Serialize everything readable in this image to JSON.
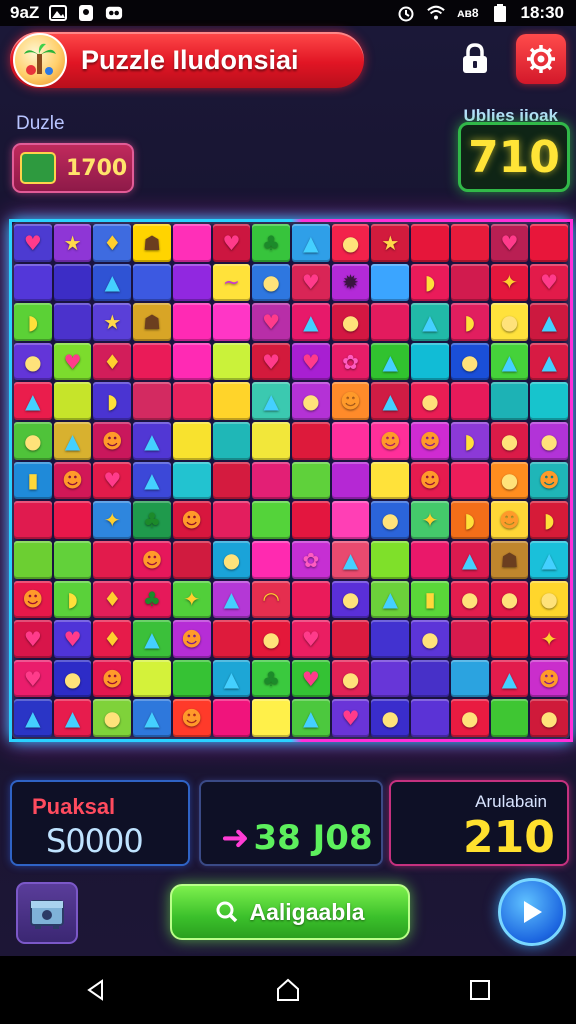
{
  "status_bar": {
    "carrier": "9aZ",
    "signal": "ᴀʙ8",
    "time": "18:30"
  },
  "header": {
    "title": "Puzzle Iludonsiai"
  },
  "left_panel": {
    "label": "Duzle",
    "chip_value": "1700"
  },
  "right_panel": {
    "label": "Ublies iioak",
    "score": "710"
  },
  "board": {
    "columns": 14,
    "rows": 13,
    "tiles": [
      [
        "#4c3bd1",
        "♥",
        "#8e36d6",
        "★",
        "#3e6be0",
        "♦",
        "#ffd400",
        "☗",
        "#ff2fb8",
        "",
        "#cc1640",
        "♥",
        "#37c43c",
        "♣",
        "#2f9fe8",
        "▲",
        "#f2224b",
        "●",
        "#d21b3d",
        "★",
        "#e6163a",
        "",
        "#e61b3b",
        "",
        "#b91f53",
        "♥",
        "#e8163a",
        ""
      ],
      [
        "#5337d9",
        "",
        "#3c2dc6",
        "",
        "#2f53d4",
        "▲",
        "#3c59e1",
        "",
        "#9128e0",
        "",
        "#ffe23a",
        "~",
        "#2e77e0",
        "●",
        "#d92556",
        "♥",
        "#b32ad8",
        "✹",
        "#3ba5ff",
        "",
        "#ea1b5a",
        "◗",
        "#d11b4e",
        "",
        "#e4173d",
        "✦",
        "#e21b4a",
        "♥"
      ],
      [
        "#5bd136",
        "◗",
        "#4b32cc",
        "",
        "#5a3fd8",
        "★",
        "#d8a526",
        "☗",
        "#ff2ab4",
        "",
        "#ff36c6",
        "",
        "#b82ea8",
        "♥",
        "#e7196a",
        "▲",
        "#d31742",
        "●",
        "#e31b5e",
        "",
        "#21b9a8",
        "▲",
        "#e11e5f",
        "◗",
        "#ffe23c",
        "●",
        "#cc193f",
        "▲"
      ],
      [
        "#6335d8",
        "●",
        "#7cdc2d",
        "♥",
        "#d21d5a",
        "♦",
        "#ea1b58",
        "",
        "#ff2ab4",
        "",
        "#caf23a",
        "",
        "#d31a3c",
        "♥",
        "#a81fd2",
        "♥",
        "#e61d68",
        "✿",
        "#31c22f",
        "▲",
        "#11bcd6",
        "",
        "#1a4fd8",
        "●",
        "#45d23a",
        "▲",
        "#d71b43",
        "▲"
      ],
      [
        "#ea1d4c",
        "▲",
        "#c6e42a",
        "",
        "#4a34d2",
        "◗",
        "#d32a61",
        "",
        "#e6235d",
        "",
        "#ffd42a",
        "",
        "#3bc9b0",
        "▲",
        "#b432d6",
        "●",
        "#ff8b2a",
        "☻",
        "#cf1c44",
        "▲",
        "#ea1d54",
        "●",
        "#e71a5a",
        "",
        "#1db2b5",
        "",
        "#17c4cd",
        ""
      ],
      [
        "#4fc33a",
        "●",
        "#d8b12f",
        "▲",
        "#c9175c",
        "☻",
        "#5137d4",
        "▲",
        "#f8e22e",
        "",
        "#1fb7b7",
        "",
        "#f2e73a",
        "",
        "#dd1a3b",
        "",
        "#ff2f9d",
        "",
        "#ff2f9a",
        "☻",
        "#cf2bd2",
        "☻",
        "#8c39d8",
        "◗",
        "#db1b48",
        "●",
        "#b233d8",
        "●"
      ],
      [
        "#1f8ad9",
        "▮",
        "#d21757",
        "☻",
        "#e21b4a",
        "♥",
        "#3c48d8",
        "▲",
        "#22c3d0",
        "",
        "#d41b3f",
        "",
        "#e31f75",
        "",
        "#5fd13b",
        "",
        "#b528d4",
        "",
        "#ffe23a",
        "",
        "#e51b4f",
        "☻",
        "#ed1d5a",
        "",
        "#ff8d1f",
        "●",
        "#1fb6b8",
        "☻"
      ],
      [
        "#e01b4f",
        "",
        "#e9174a",
        "",
        "#2e86de",
        "✦",
        "#1f9a4c",
        "♣",
        "#d8163e",
        "☻",
        "#e31e5e",
        "",
        "#54d33a",
        "",
        "#e3163f",
        "",
        "#ff3fb5",
        "",
        "#2b64da",
        "●",
        "#44c96b",
        "✦",
        "#f36e19",
        "◗",
        "#ffd737",
        "☻",
        "#d61b38",
        "◗"
      ],
      [
        "#6ccf32",
        "",
        "#62d13a",
        "",
        "#e21b4c",
        "",
        "#e6175b",
        "☻",
        "#d01b3f",
        "",
        "#1aa3d9",
        "●",
        "#ff2ab0",
        "",
        "#c62fd3",
        "✿",
        "#e84a6f",
        "▲",
        "#7fe02a",
        "",
        "#ea186a",
        "",
        "#db1a4f",
        "▲",
        "#c0862d",
        "☗",
        "#1ac0da",
        "▲"
      ],
      [
        "#e6184a",
        "☻",
        "#5ad13a",
        "◗",
        "#e11e59",
        "♦",
        "#e6195a",
        "♣",
        "#51cf3a",
        "✦",
        "#b438d6",
        "▲",
        "#e52e4f",
        "◠",
        "#ea1b5a",
        "",
        "#5a2fd8",
        "●",
        "#6bd13a",
        "▲",
        "#5ad739",
        "▮",
        "#e31d4e",
        "●",
        "#e21947",
        "●",
        "#ffd62c",
        "●"
      ],
      [
        "#d8154a",
        "♥",
        "#4f34d8",
        "♥",
        "#e61b4a",
        "♦",
        "#3bc03a",
        "▲",
        "#b62dd6",
        "☻",
        "#de1b3c",
        "",
        "#e4183a",
        "●",
        "#ea1e62",
        "♥",
        "#db1b3f",
        "",
        "#4232d0",
        "",
        "#5c35d8",
        "●",
        "#d81a4d",
        "",
        "#e61a3a",
        "",
        "#e6164a",
        "✦"
      ],
      [
        "#ea1d6c",
        "♥",
        "#2d2cc7",
        "●",
        "#e3174f",
        "☻",
        "#d4f23a",
        "",
        "#36c234",
        "",
        "#1da6d6",
        "▲",
        "#3ac93e",
        "♣",
        "#34c234",
        "♥",
        "#e22256",
        "●",
        "#6736d8",
        "",
        "#4730c8",
        "",
        "#2ba3e0",
        "",
        "#e21c4c",
        "▲",
        "#ca2ecc",
        "☻"
      ],
      [
        "#2a35c6",
        "▲",
        "#e71c4d",
        "▲",
        "#7fd23a",
        "●",
        "#2e78dc",
        "▲",
        "#ff3a2a",
        "☻",
        "#f0147c",
        "",
        "#fff04a",
        "",
        "#4cc83e",
        "▲",
        "#6a34d8",
        "♥",
        "#3a2dcc",
        "●",
        "#5b33d6",
        "",
        "#e91b41",
        "●",
        "#3fc633",
        "",
        "#cf1a3a",
        "●"
      ]
    ]
  },
  "stats": {
    "panel1_label": "Puaksal",
    "panel1_value": "S0000",
    "panel2_value": "38 J08",
    "panel3_label": "Arulabain",
    "panel3_value": "210"
  },
  "actions": {
    "main_button_label": "Aaligaabla"
  },
  "colors": {
    "board_glow_left": "#2ad1ff",
    "board_glow_right": "#ff2fd8",
    "header_red": "#e11524",
    "accent_green": "#3bc02b",
    "score_yellow": "#ffe437"
  }
}
